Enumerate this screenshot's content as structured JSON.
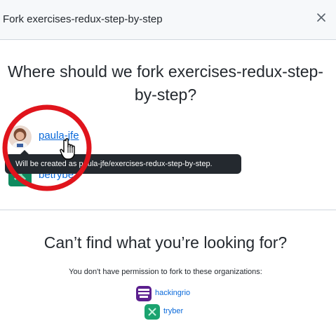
{
  "header": {
    "title": "Fork exercises-redux-step-by-step",
    "close_icon": "close-icon"
  },
  "main": {
    "question": "Where should we fork exercises-redux-step-by-step?",
    "owners": [
      {
        "login": "paula-jfe",
        "avatar_icon": "user-avatar"
      },
      {
        "login": "betrybe",
        "avatar_icon": "org-avatar-betrybe"
      }
    ],
    "tooltip": "Will be created as paula-jfe/exercises-redux-step-by-step."
  },
  "no_permission": {
    "heading": "Can’t find what you’re looking for?",
    "text": "You don't have permission to fork to these organizations:",
    "orgs": [
      {
        "name": "hackingrio",
        "avatar_icon": "org-avatar-hackingrio"
      },
      {
        "name": "tryber",
        "avatar_icon": "org-avatar-tryber"
      }
    ]
  },
  "colors": {
    "link": "#0969da",
    "annotation_circle": "#e0141c",
    "tooltip_bg": "#24292f"
  }
}
